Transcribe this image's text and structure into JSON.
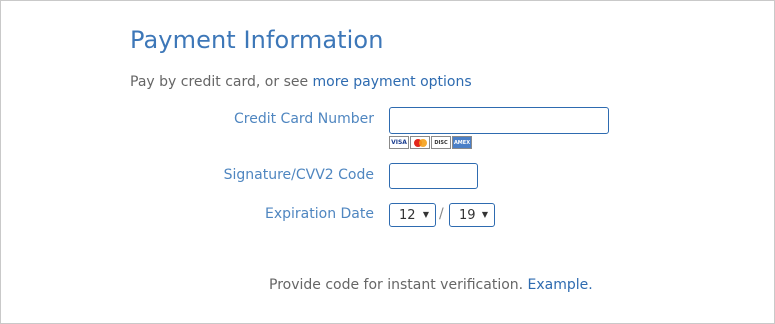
{
  "payment": {
    "title": "Payment Information",
    "subtitle_text": "Pay by credit card, or see ",
    "subtitle_link": "more payment options",
    "card_number_label": "Credit Card Number",
    "card_number_value": "",
    "card_logos": [
      "VISA",
      "MasterCard",
      "DISCOVER",
      "AMEX"
    ],
    "cvv_label": "Signature/CVV2 Code",
    "cvv_value": "",
    "expiration_label": "Expiration Date",
    "exp_month": "12",
    "exp_separator": "/",
    "exp_year": "19",
    "footer_text": "Provide code for instant verification. ",
    "footer_link": "Example."
  },
  "colors": {
    "title": "#3d77b8",
    "label": "#4f86c0",
    "link": "#2e6bb0",
    "input_border": "#2e6bb0",
    "text": "#666666"
  }
}
